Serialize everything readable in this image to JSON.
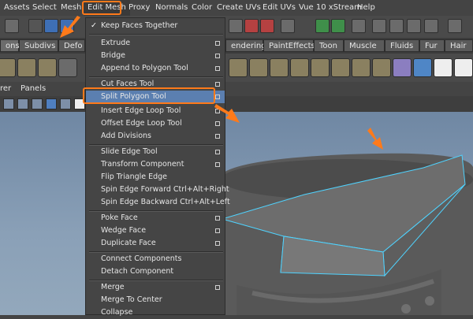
{
  "menubar": {
    "items": [
      "Assets",
      "Select",
      "Mesh",
      "Edit Mesh",
      "Proxy",
      "Normals",
      "Color",
      "Create UVs",
      "Edit UVs",
      "Vue 10 xStream",
      "Help"
    ]
  },
  "shelf": {
    "tabs": [
      "ons",
      "Subdivs",
      "Defo",
      "endering",
      "PaintEffects",
      "Toon",
      "Muscle",
      "Fluids",
      "Fur",
      "Hair"
    ]
  },
  "panel": {
    "labels": [
      "rer",
      "Panels"
    ]
  },
  "dropdown": {
    "items": [
      {
        "label": "Keep Faces Together",
        "check": "✓",
        "option": false
      },
      {
        "label": "Extrude",
        "option": true
      },
      {
        "label": "Bridge",
        "option": true
      },
      {
        "label": "Append to Polygon Tool",
        "option": true
      },
      {
        "label": "Cut Faces Tool",
        "option": true
      },
      {
        "label": "Split Polygon Tool",
        "option": true,
        "highlight": true
      },
      {
        "label": "Insert Edge Loop Tool",
        "option": true
      },
      {
        "label": "Offset Edge Loop Tool",
        "option": true
      },
      {
        "label": "Add Divisions",
        "option": true
      },
      {
        "label": "Slide Edge Tool",
        "option": true
      },
      {
        "label": "Transform Component",
        "option": true
      },
      {
        "label": "Flip Triangle Edge",
        "option": false
      },
      {
        "label": "Spin Edge Forward  Ctrl+Alt+Right",
        "option": false
      },
      {
        "label": "Spin Edge Backward  Ctrl+Alt+Left",
        "option": false
      },
      {
        "label": "Poke Face",
        "option": true
      },
      {
        "label": "Wedge Face",
        "option": true
      },
      {
        "label": "Duplicate Face",
        "option": true
      },
      {
        "label": "Connect Components",
        "option": false
      },
      {
        "label": "Detach Component",
        "option": false
      },
      {
        "label": "Merge",
        "option": true
      },
      {
        "label": "Merge To Center",
        "option": false
      },
      {
        "label": "Collapse",
        "option": false
      }
    ]
  },
  "colors": {
    "highlight_outline": "#ff7a1a",
    "selected_edge": "#4fd3ff",
    "menu_highlight": "#5b7fb0"
  }
}
